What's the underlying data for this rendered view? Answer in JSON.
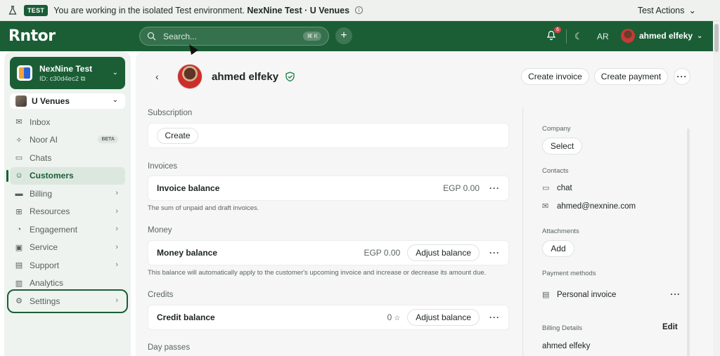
{
  "banner": {
    "badge": "TEST",
    "text_prefix": "You are working in the isolated Test environment.",
    "text_bold": "NexNine Test · U Venues",
    "actions_label": "Test Actions"
  },
  "topbar": {
    "logo": "Rntor",
    "search_placeholder": "Search...",
    "search_shortcut": "⌘ K",
    "notif_count": "6",
    "lang": "AR",
    "user_name": "ahmed elfeky"
  },
  "sidebar": {
    "org_name": "NexNine Test",
    "org_id": "ID: c30d4ec2",
    "venue": "U Venues",
    "items": [
      {
        "label": "Inbox",
        "icon": "inbox-icon",
        "glyph": "✉"
      },
      {
        "label": "Noor AI",
        "icon": "sparkle-icon",
        "glyph": "✧",
        "badge": "BETA"
      },
      {
        "label": "Chats",
        "icon": "chat-icon",
        "glyph": "▭"
      },
      {
        "label": "Customers",
        "icon": "users-icon",
        "glyph": "☺"
      },
      {
        "label": "Billing",
        "icon": "billing-icon",
        "glyph": "▬"
      },
      {
        "label": "Resources",
        "icon": "grid-icon",
        "glyph": "⊞"
      },
      {
        "label": "Engagement",
        "icon": "rss-icon",
        "glyph": "◔"
      },
      {
        "label": "Service",
        "icon": "service-icon",
        "glyph": "▣"
      },
      {
        "label": "Support",
        "icon": "support-icon",
        "glyph": "▤"
      },
      {
        "label": "Analytics",
        "icon": "analytics-icon",
        "glyph": "▥"
      },
      {
        "label": "Settings",
        "icon": "gear-icon",
        "glyph": "⚙"
      }
    ]
  },
  "customer": {
    "name": "ahmed elfeky",
    "create_invoice": "Create invoice",
    "create_payment": "Create payment",
    "more": "···"
  },
  "sections": {
    "subscription": "Subscription",
    "subscription_create": "Create",
    "invoices": "Invoices",
    "invoice_balance": "Invoice balance",
    "invoice_amount": "EGP 0.00",
    "invoice_hint": "The sum of unpaid and draft invoices.",
    "money": "Money",
    "money_balance": "Money balance",
    "money_amount": "EGP 0.00",
    "adjust_balance": "Adjust balance",
    "money_hint": "This balance will automatically apply to the customer's upcoming invoice and increase or decrease its amount due.",
    "credits": "Credits",
    "credit_balance": "Credit balance",
    "credit_amount": "0",
    "day_passes": "Day passes"
  },
  "details": {
    "company": "Company",
    "company_select": "Select",
    "contacts": "Contacts",
    "contact_chat": "chat",
    "contact_email": "ahmed@nexnine.com",
    "attachments": "Attachments",
    "attachments_add": "Add",
    "payment_methods": "Payment methods",
    "payment_method": "Personal invoice",
    "billing_details": "Billing Details",
    "billing_edit": "Edit",
    "billing_name": "ahmed elfeky"
  }
}
